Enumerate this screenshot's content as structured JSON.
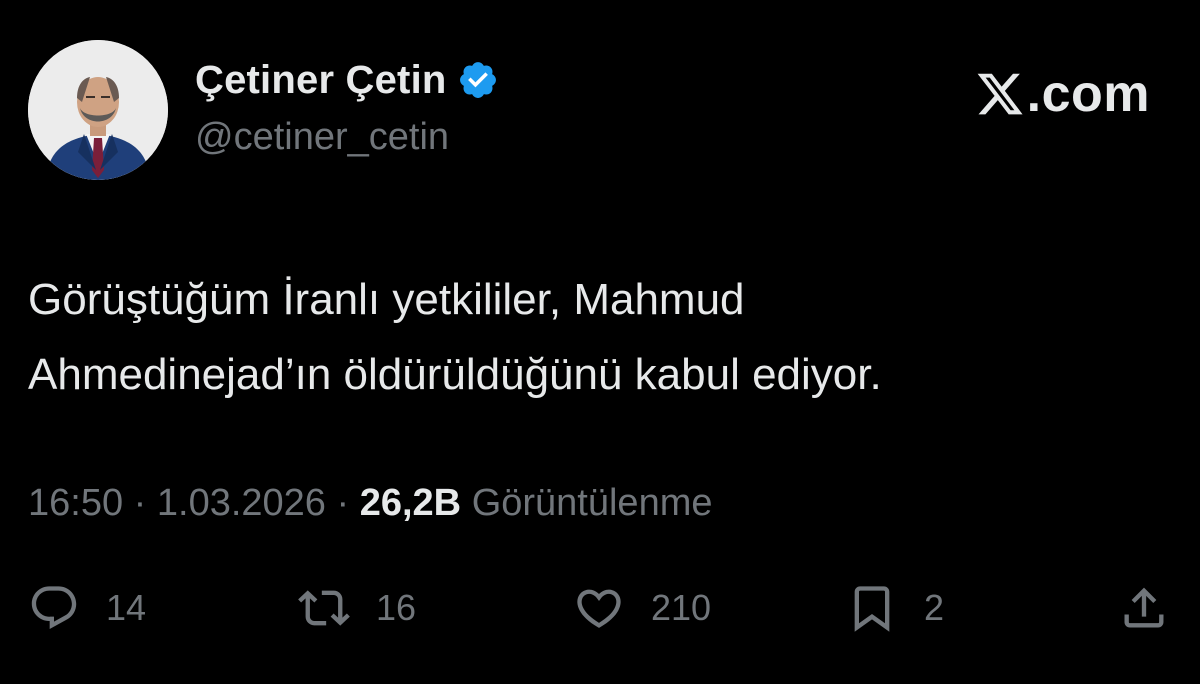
{
  "author": {
    "display_name": "Çetiner Çetin",
    "handle": "@cetiner_cetin",
    "verified": true
  },
  "brand": {
    "label": ".com"
  },
  "tweet": {
    "line1": "Görüştüğüm İranlı yetkililer, Mahmud",
    "line2": "Ahmedinejad’ın öldürüldüğünü kabul ediyor."
  },
  "meta": {
    "time": "16:50",
    "separator": " · ",
    "date": "1.03.2026",
    "views_count": "26,2B",
    "views_label": "Görüntülenme"
  },
  "actions": {
    "replies": "14",
    "reposts": "16",
    "likes": "210",
    "bookmarks": "2"
  },
  "colors": {
    "background": "#000000",
    "primary_text": "#e7e9ea",
    "secondary_text": "#71767b",
    "verified_badge": "#1d9bf0"
  },
  "icons": {
    "reply": "reply-icon",
    "repost": "repost-icon",
    "like": "heart-icon",
    "bookmark": "bookmark-icon",
    "share": "share-icon",
    "verified": "verified-badge-icon",
    "brand": "x-logo-icon"
  }
}
